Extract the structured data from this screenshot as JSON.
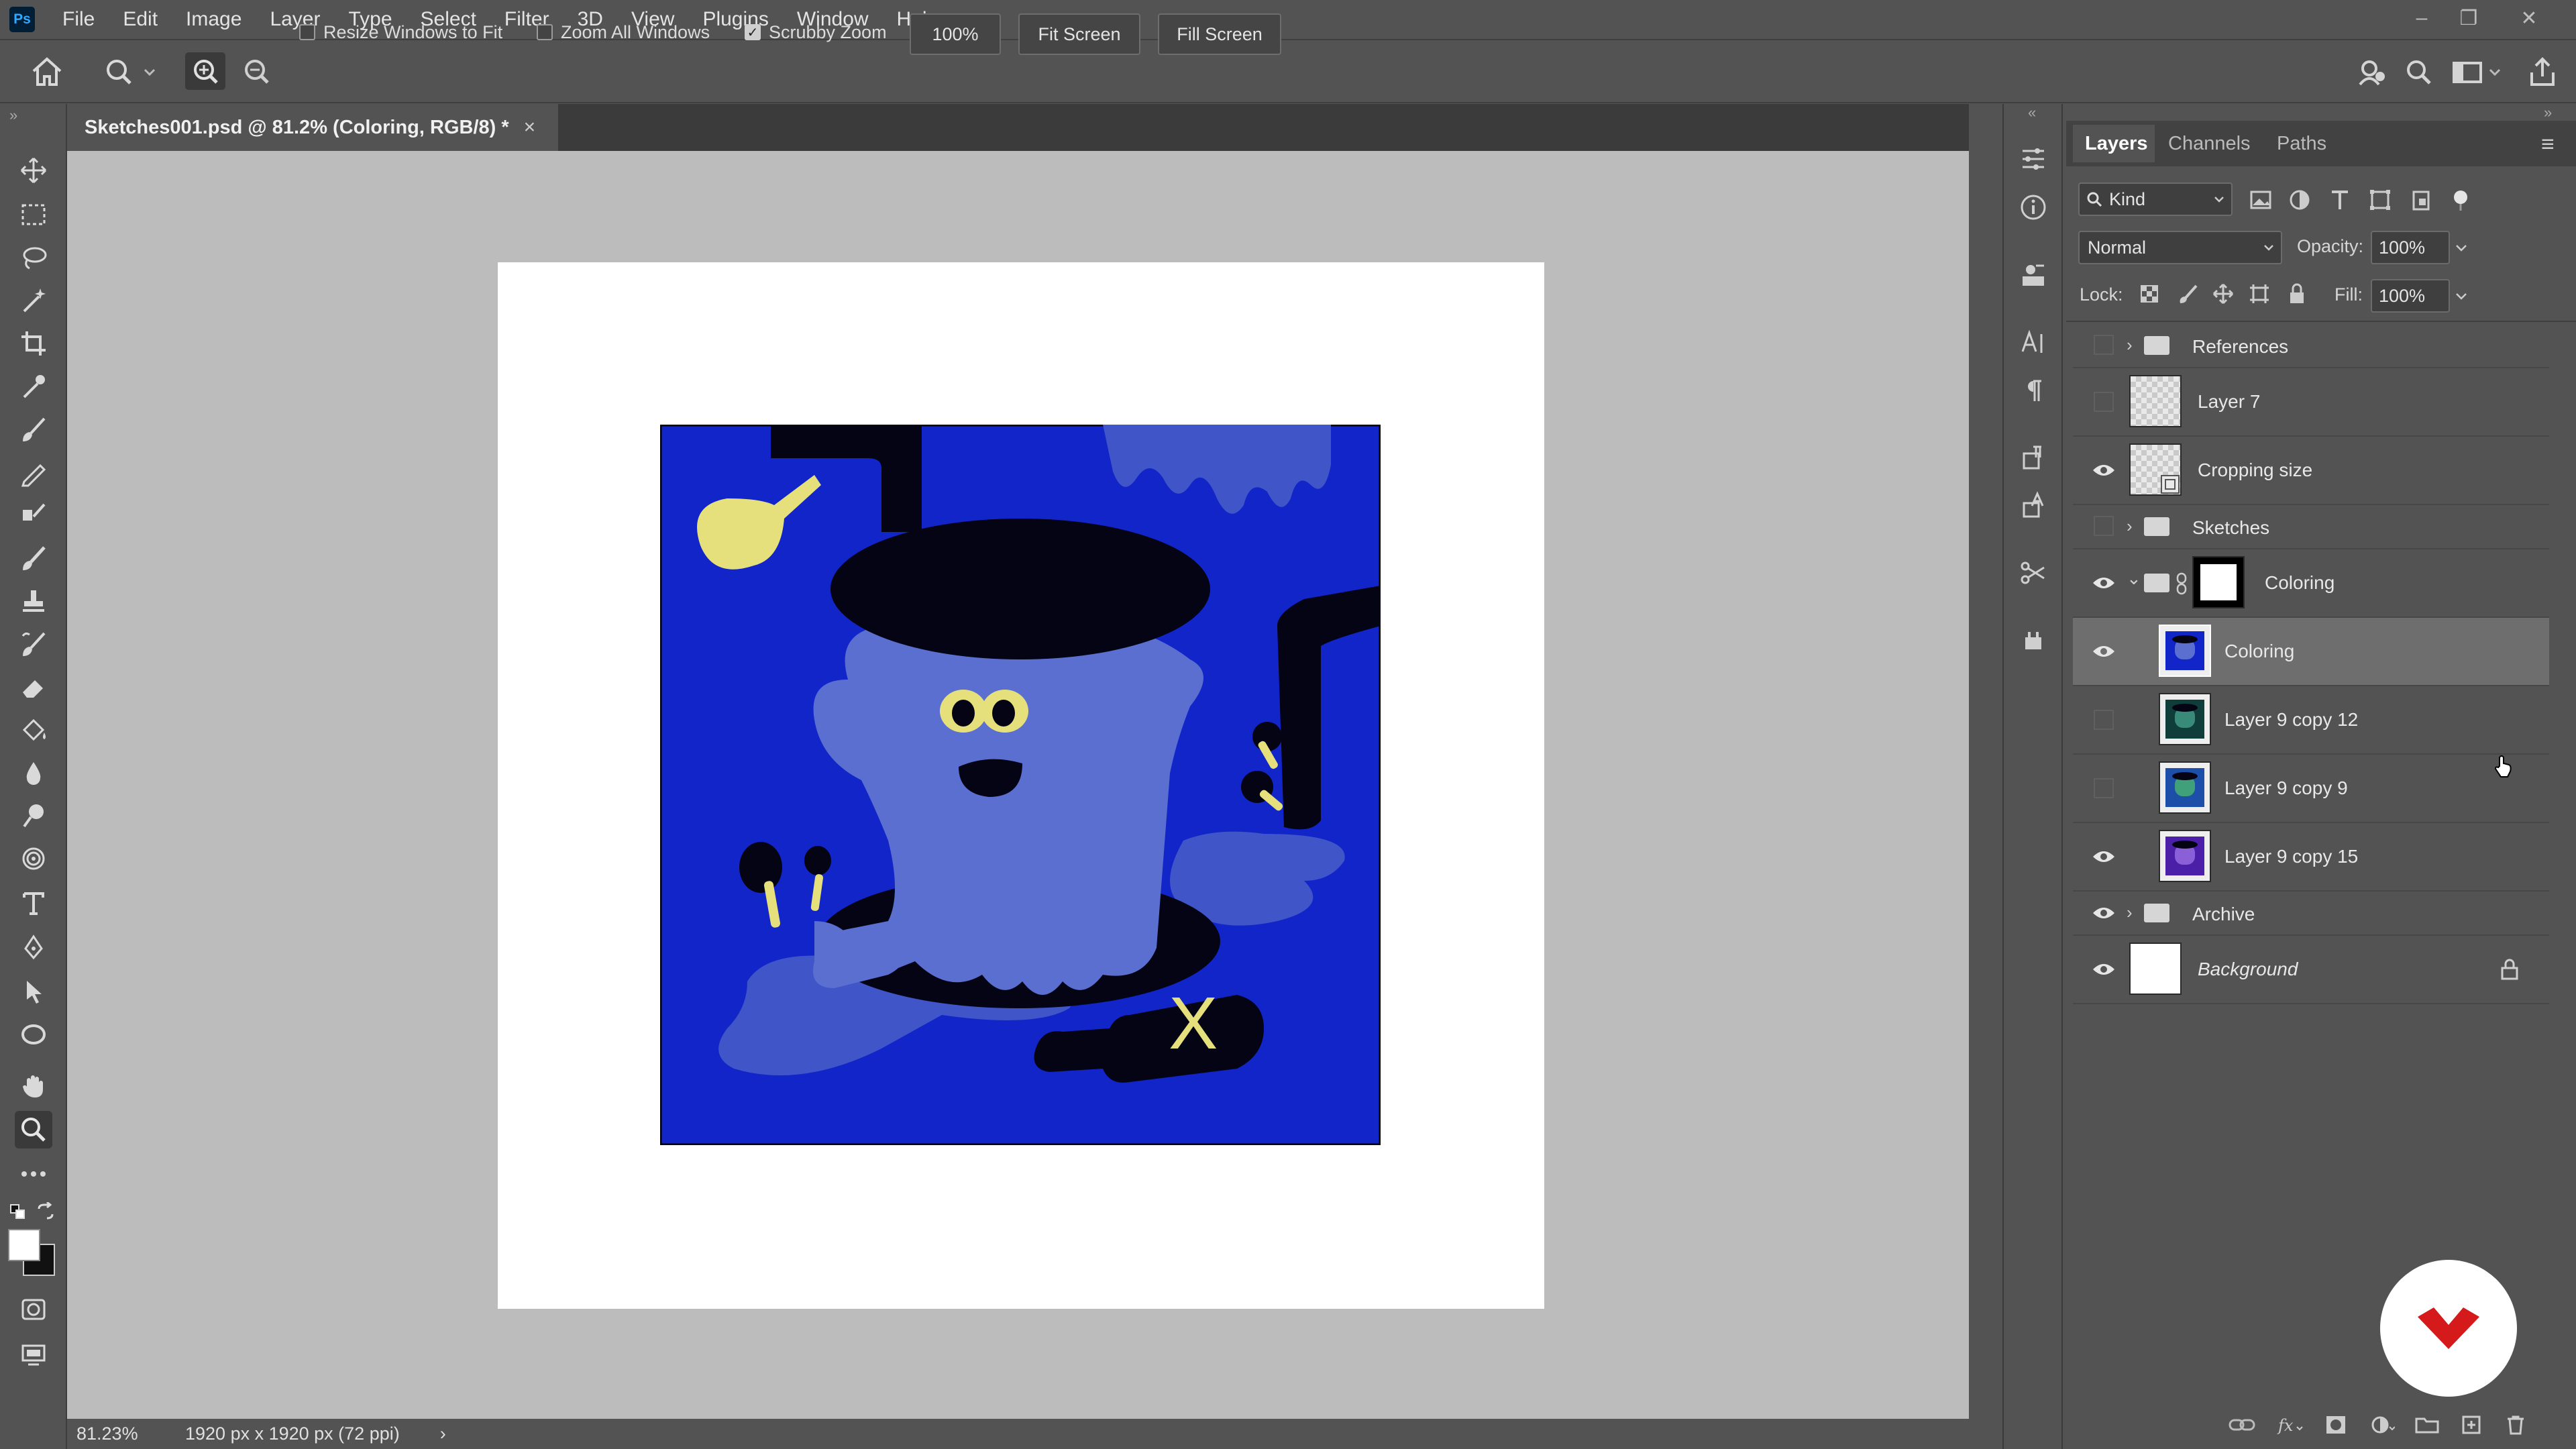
{
  "app": {
    "logo": "Ps",
    "menus": [
      "File",
      "Edit",
      "Image",
      "Layer",
      "Type",
      "Select",
      "Filter",
      "3D",
      "View",
      "Plugins",
      "Window",
      "Help"
    ],
    "window_controls": {
      "minimize": "–",
      "restore": "❐",
      "close": "✕"
    }
  },
  "options_bar": {
    "resize_windows": "Resize Windows to Fit",
    "resize_windows_checked": false,
    "zoom_all": "Zoom All Windows",
    "zoom_all_checked": false,
    "scrubby_zoom": "Scrubby Zoom",
    "scrubby_zoom_checked": true,
    "zoom_value": "100%",
    "fit_screen": "Fit Screen",
    "fill_screen": "Fill Screen",
    "check_mark": "✓"
  },
  "document": {
    "tab_title": "Sketches001.psd @ 81.2% (Coloring, RGB/8) *",
    "close": "×",
    "artwork_label": "X"
  },
  "status": {
    "zoom": "81.23%",
    "doc_info": "1920 px x 1920 px (72 ppi)",
    "arrow": "›"
  },
  "panel": {
    "tabs": [
      "Layers",
      "Channels",
      "Paths"
    ],
    "active_tab": "Layers",
    "filter_kind": "Kind",
    "blend_mode": "Normal",
    "opacity_label": "Opacity:",
    "opacity_value": "100%",
    "lock_label": "Lock:",
    "fill_label": "Fill:",
    "fill_value": "100%",
    "menu_icon": "≡",
    "collapse_left": "«",
    "collapse_right": "»"
  },
  "layers": [
    {
      "name": "References",
      "visible": false,
      "type": "group",
      "collapsed": true
    },
    {
      "name": "Layer 7",
      "visible": false,
      "type": "layer"
    },
    {
      "name": "Cropping size",
      "visible": true,
      "type": "layer"
    },
    {
      "name": "Sketches",
      "visible": false,
      "type": "group",
      "collapsed": true
    },
    {
      "name": "Coloring",
      "visible": true,
      "type": "group",
      "collapsed": false
    },
    {
      "name": "Coloring",
      "visible": true,
      "type": "layer",
      "selected": true
    },
    {
      "name": "Layer 9 copy 12",
      "visible": false,
      "type": "layer"
    },
    {
      "name": "Layer 9 copy 9",
      "visible": false,
      "type": "layer"
    },
    {
      "name": "Layer 9 copy 15",
      "visible": true,
      "type": "layer"
    },
    {
      "name": "Archive",
      "visible": true,
      "type": "group",
      "collapsed": true
    },
    {
      "name": "Background",
      "visible": true,
      "type": "layer",
      "locked": true
    }
  ],
  "icons": {
    "eye": "👁",
    "chevron_right": "›",
    "chevron_down": "⌄",
    "lock": "🔒",
    "link": "🔗"
  },
  "colors": {
    "art_bg": "#1125c9",
    "ghost": "#5a6fd0",
    "dark": "#040414",
    "yellow": "#e6e07c",
    "puddle": "#3f55c8",
    "brand_red": "#d41a1a"
  }
}
